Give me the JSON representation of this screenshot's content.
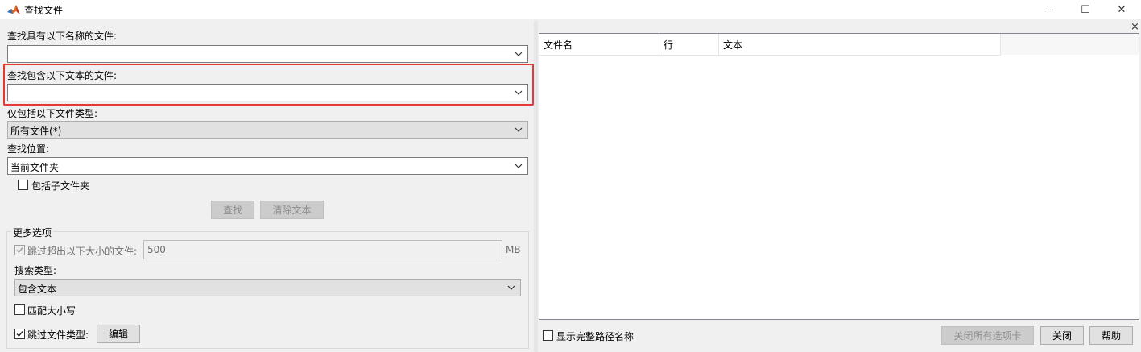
{
  "window": {
    "title": "查找文件",
    "minimize_glyph": "—",
    "maximize_glyph": "☐",
    "close_glyph": "✕"
  },
  "form": {
    "name_label": "查找具有以下名称的文件:",
    "name_value": "",
    "text_label": "查找包含以下文本的文件:",
    "text_value": "",
    "type_label": "仅包括以下文件类型:",
    "type_value": "所有文件(*)",
    "location_label": "查找位置:",
    "location_value": "当前文件夹",
    "subfolder_label": "包括子文件夹",
    "find_button": "查找",
    "clear_button": "清除文本"
  },
  "more_options": {
    "legend": "更多选项",
    "skip_size_label": "跳过超出以下大小的文件:",
    "skip_size_value": "500",
    "size_unit": "MB",
    "search_type_label": "搜索类型:",
    "search_type_value": "包含文本",
    "match_case_label": "匹配大小写",
    "skip_types_label": "跳过文件类型:",
    "edit_button": "编辑"
  },
  "results": {
    "close_pane_glyph": "×",
    "columns": [
      "文件名",
      "行",
      "文本"
    ],
    "show_full_path_label": "显示完整路径名称",
    "close_all_tabs_button": "关闭所有选项卡",
    "close_button": "关闭",
    "help_button": "帮助"
  },
  "colors": {
    "highlight": "#e53935"
  }
}
